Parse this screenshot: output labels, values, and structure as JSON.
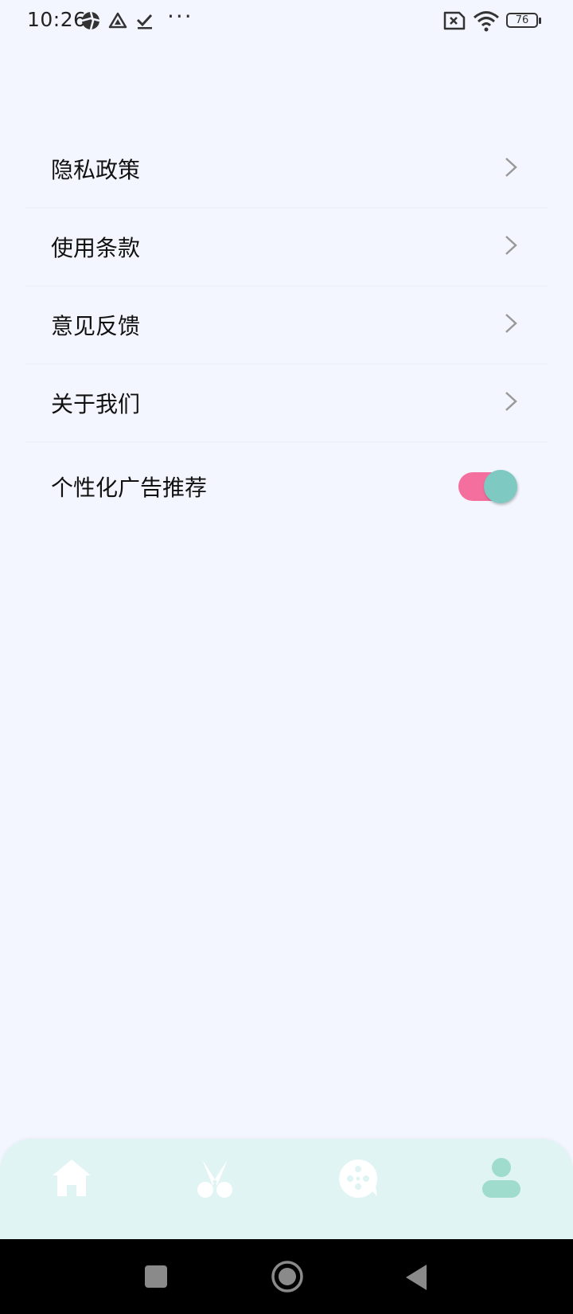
{
  "status_bar": {
    "time": "10:26",
    "dots": "···",
    "battery": "76",
    "icons": [
      "aperture-icon",
      "drive-icon",
      "check-icon",
      "no-sim-icon",
      "wifi-icon",
      "battery-icon"
    ]
  },
  "menu": {
    "items": [
      {
        "label": "隐私政策",
        "icon": "chevron-right-icon"
      },
      {
        "label": "使用条款",
        "icon": "chevron-right-icon"
      },
      {
        "label": "意见反馈",
        "icon": "chevron-right-icon"
      },
      {
        "label": "关于我们",
        "icon": "chevron-right-icon"
      }
    ],
    "toggle": {
      "label": "个性化广告推荐",
      "on": true
    }
  },
  "tabs": [
    "home-icon",
    "scissors-icon",
    "chat-icon",
    "profile-icon"
  ],
  "colors": {
    "background": "#f3f6fe",
    "tab_bar": "#dff4f3",
    "toggle_track": "#f46f9d",
    "toggle_thumb": "#7ec9c2",
    "active_tab": "#9fdccd"
  }
}
